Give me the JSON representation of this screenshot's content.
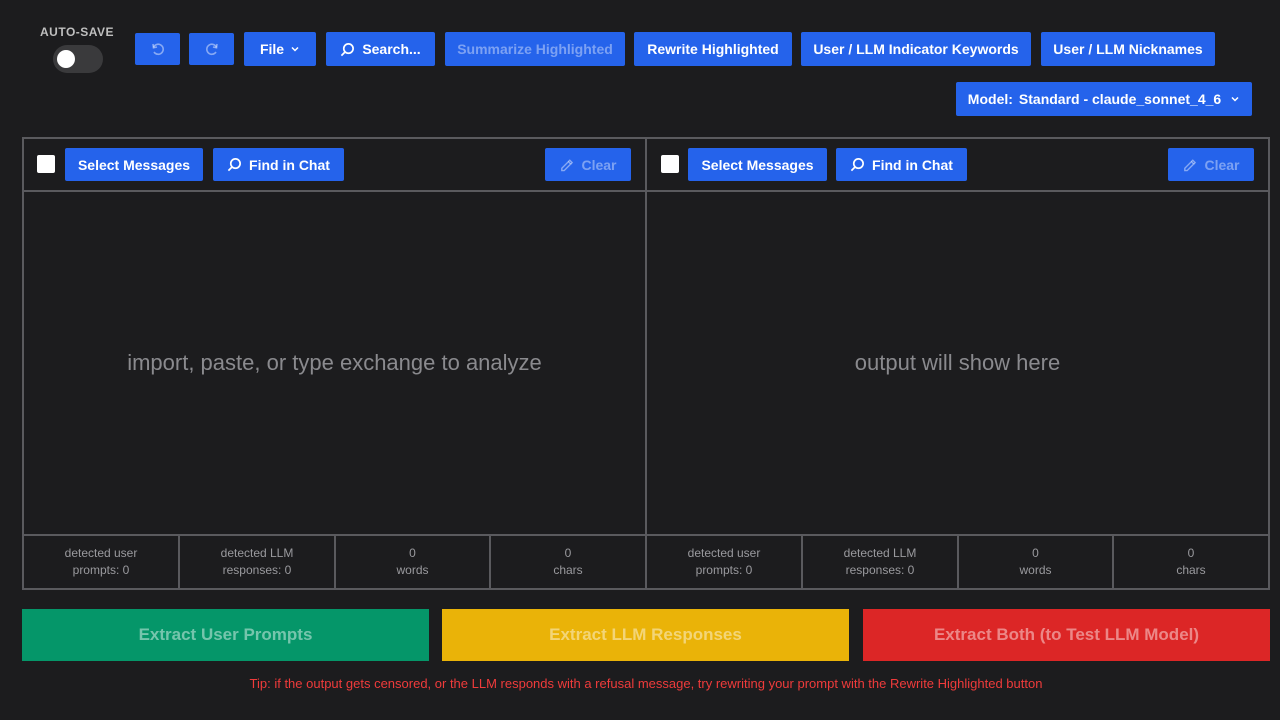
{
  "toolbar": {
    "autosave_label": "AUTO-SAVE",
    "autosave_on": false,
    "file_label": "File",
    "search_label": "Search...",
    "summarize_label": "Summarize Highlighted",
    "rewrite_label": "Rewrite Highlighted",
    "keywords_label": "User / LLM Indicator Keywords",
    "nicknames_label": "User / LLM Nicknames",
    "model_label": "Model:",
    "model_value": "Standard - claude_sonnet_4_6"
  },
  "input_pane": {
    "select_label": "Select Messages",
    "find_label": "Find in Chat",
    "clear_label": "Clear",
    "placeholder": "import, paste, or type exchange to analyze",
    "stats": [
      {
        "line1": "detected user",
        "line2": "prompts: 0"
      },
      {
        "line1": "detected LLM",
        "line2": "responses: 0"
      },
      {
        "line1": "0",
        "line2": "words"
      },
      {
        "line1": "0",
        "line2": "chars"
      }
    ]
  },
  "output_pane": {
    "select_label": "Select Messages",
    "find_label": "Find in Chat",
    "clear_label": "Clear",
    "placeholder": "output will show here",
    "stats": [
      {
        "line1": "detected user",
        "line2": "prompts: 0"
      },
      {
        "line1": "detected LLM",
        "line2": "responses: 0"
      },
      {
        "line1": "0",
        "line2": "words"
      },
      {
        "line1": "0",
        "line2": "chars"
      }
    ]
  },
  "actions": {
    "extract_user": "Extract User Prompts",
    "extract_llm": "Extract LLM Responses",
    "extract_both": "Extract Both (to Test LLM Model)"
  },
  "tip": "Tip: if the output gets censored, or the LLM responds with a refusal message, try rewriting your prompt with the Rewrite Highlighted button",
  "colors": {
    "accent_blue": "#2563eb",
    "extract_user_bg": "#059669",
    "extract_llm_bg": "#eab308",
    "extract_both_bg": "#dc2626",
    "tip_text": "#ef3b3b"
  }
}
